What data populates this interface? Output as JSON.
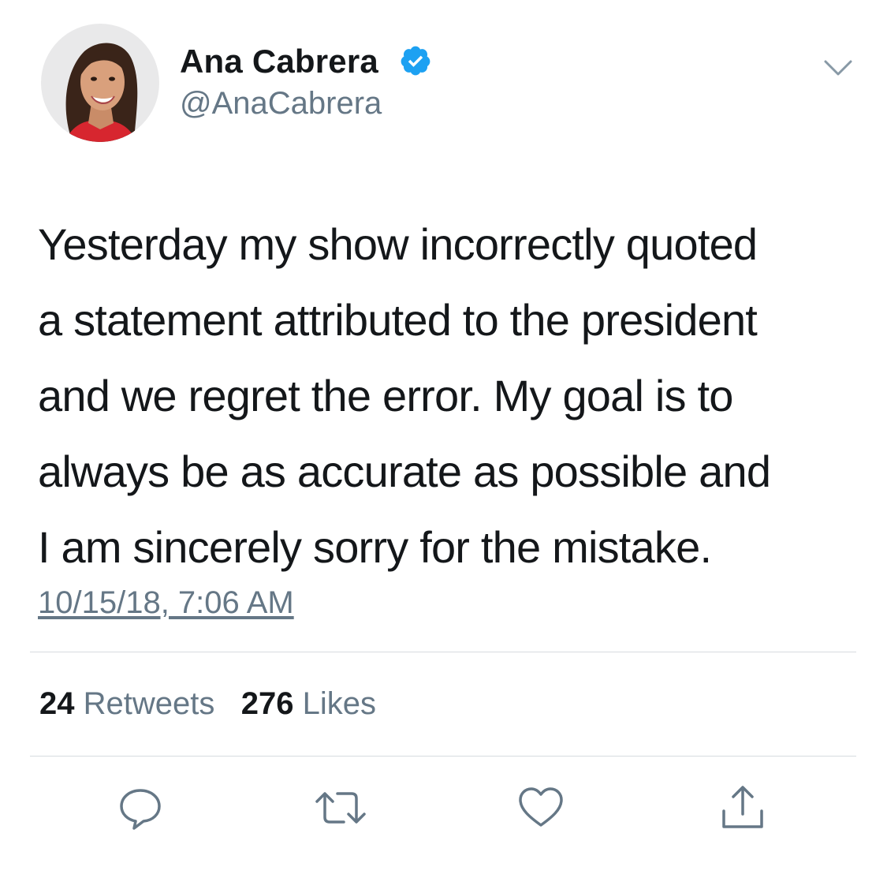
{
  "user": {
    "display_name": "Ana Cabrera",
    "handle": "@AnaCabrera",
    "verified": true
  },
  "tweet": {
    "lines": [
      "Yesterday my show incorrectly quoted",
      "a statement attributed to the president",
      "and we regret the error. My goal is to",
      "always be as accurate as possible and",
      "I am sincerely sorry for the mistake."
    ],
    "timestamp": "10/15/18, 7:06 AM"
  },
  "stats": {
    "retweets_count": "24",
    "retweets_label": "Retweets",
    "likes_count": "276",
    "likes_label": "Likes"
  },
  "icons": {
    "verified": "verified-badge-icon",
    "menu": "chevron-down-icon",
    "reply": "reply-icon",
    "retweet": "retweet-icon",
    "like": "heart-icon",
    "share": "share-icon"
  },
  "colors": {
    "text": "#14171a",
    "secondary": "#657786",
    "verified_blue": "#1da1f2",
    "divider": "#d7dbdf"
  }
}
